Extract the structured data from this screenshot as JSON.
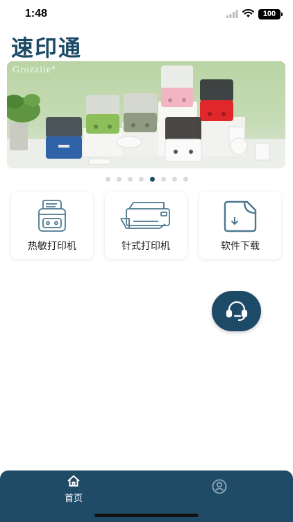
{
  "status_bar": {
    "time": "1:48",
    "battery": "100"
  },
  "app_title": "速印通",
  "banner": {
    "brand": "Grozziie°",
    "slides": 8,
    "active_slide": 5
  },
  "features": [
    {
      "label": "热敏打印机",
      "icon": "thermal-printer-icon"
    },
    {
      "label": "针式打印机",
      "icon": "dot-matrix-printer-icon"
    },
    {
      "label": "软件下载",
      "icon": "file-download-icon"
    }
  ],
  "support": {
    "icon": "headset-icon"
  },
  "tab_bar": {
    "tabs": [
      {
        "label": "首页",
        "icon": "home-icon",
        "active": true
      },
      {
        "label": "",
        "icon": "user-icon",
        "active": false
      }
    ]
  },
  "colors": {
    "brand": "#1d4a66",
    "tab_bar": "#1f4b67",
    "icon_stroke": "#4d7890",
    "dot_inactive": "#d6dadd"
  }
}
